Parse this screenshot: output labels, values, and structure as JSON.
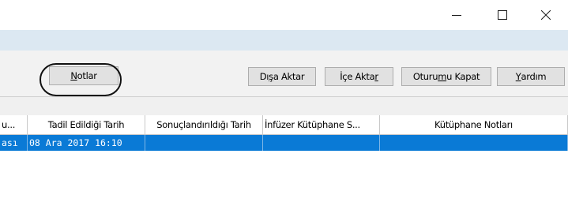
{
  "window_controls": {
    "minimize": "–",
    "maximize": "☐",
    "close": "✕"
  },
  "toolbar": {
    "notlar": {
      "label": "Notlar",
      "underline_char": "N"
    },
    "disa_aktar": {
      "pre": "Dı",
      "u": "ş",
      "post": "a Aktar"
    },
    "ice_aktar": {
      "pre": "İçe Akta",
      "u": "r",
      "post": ""
    },
    "oturumu_kapat": {
      "pre": "Oturu",
      "u": "m",
      "post": "u Kapat"
    },
    "yardim": {
      "pre": "",
      "u": "Y",
      "post": "ardım"
    }
  },
  "table": {
    "columns": [
      "u...",
      "Tadil Edildiği Tarih",
      "Sonuçlandırıldığı Tarih",
      "İnfüzer Kütüphane S...",
      "Kütüphane Notları"
    ],
    "rows": [
      {
        "cells": [
          "ası",
          "08 Ara 2017 16:10",
          "",
          "",
          ""
        ],
        "selected": true
      }
    ]
  },
  "colors": {
    "selection": "#0a7ad6",
    "strip": "#dce8f2",
    "toolbar_bg": "#f2f2f2",
    "button_bg": "#e1e1e1"
  }
}
